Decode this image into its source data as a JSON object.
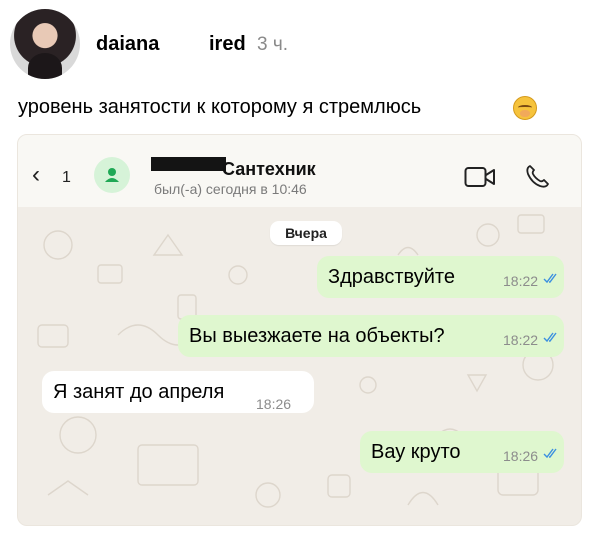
{
  "post": {
    "username": "daiana",
    "username_tail": "ired",
    "time": "3 ч.",
    "caption": "уровень занятости к которому я стремлюсь",
    "emoji_icon": "shushing-face-emoji"
  },
  "chat": {
    "header": {
      "back_icon": "chevron-left-icon",
      "back_count": "1",
      "contact_name": "Сантехник",
      "last_seen": "был(-а) сегодня в 10:46",
      "video_icon": "video-call-icon",
      "call_icon": "phone-icon"
    },
    "date_divider": "Вчера",
    "messages": [
      {
        "direction": "outgoing",
        "text": "Здравствуйте",
        "time": "18:22",
        "read": true
      },
      {
        "direction": "outgoing",
        "text": "Вы выезжаете на объекты?",
        "time": "18:22",
        "read": true
      },
      {
        "direction": "incoming",
        "text": "Я занят до апреля",
        "time": "18:26"
      },
      {
        "direction": "outgoing",
        "text": "Вау круто",
        "time": "18:26",
        "read": true
      }
    ],
    "colors": {
      "outgoing_bubble": "#dff7cf",
      "incoming_bubble": "#ffffff",
      "read_ticks": "#3b8fe0",
      "avatar_green": "#1fa855"
    }
  }
}
